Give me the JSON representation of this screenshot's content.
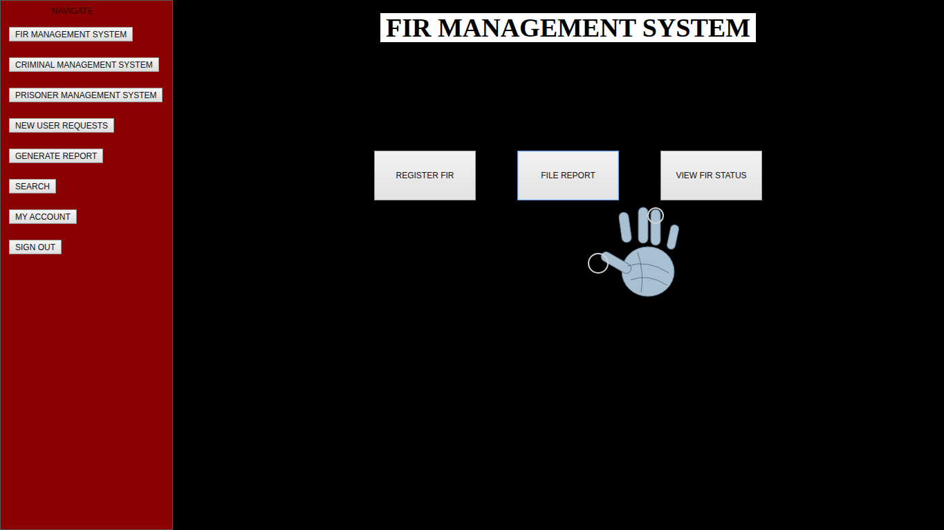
{
  "sidebar": {
    "heading": "NAVIGATE",
    "items": [
      {
        "label": "FIR MANAGEMENT SYSTEM"
      },
      {
        "label": "CRIMINAL MANAGEMENT SYSTEM"
      },
      {
        "label": "PRISONER MANAGEMENT SYSTEM"
      },
      {
        "label": "NEW USER REQUESTS"
      },
      {
        "label": "GENERATE REPORT"
      },
      {
        "label": "SEARCH"
      },
      {
        "label": "MY ACCOUNT"
      },
      {
        "label": "SIGN OUT"
      }
    ]
  },
  "title": "FIR MANAGEMENT SYSTEM",
  "actions": [
    {
      "label": "REGISTER FIR",
      "focused": false
    },
    {
      "label": "FILE REPORT",
      "focused": true
    },
    {
      "label": "VIEW FIR STATUS",
      "focused": false
    }
  ]
}
